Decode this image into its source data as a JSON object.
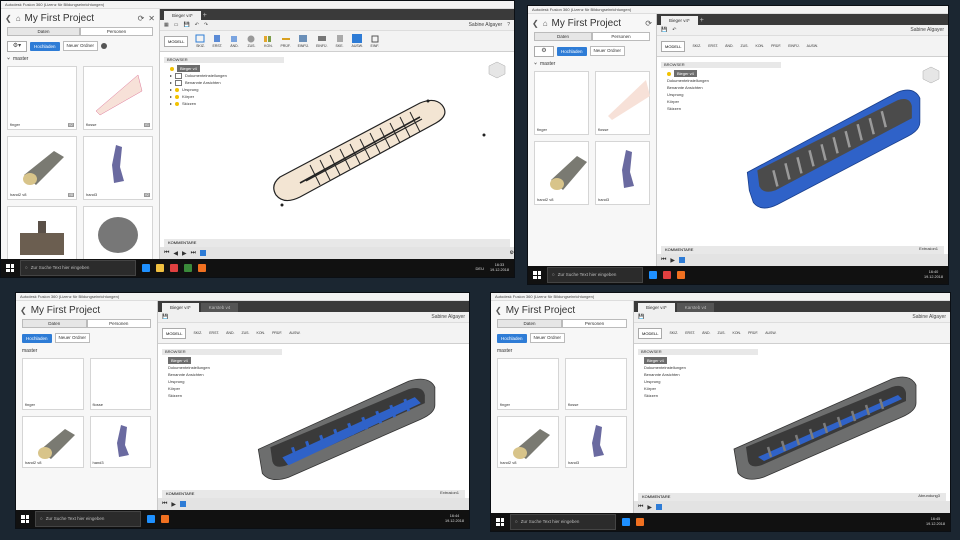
{
  "app_title": "Autodesk Fusion 360 (Lizenz für Bildungseinrichtungen)",
  "project": {
    "name": "My First Project"
  },
  "left_tabs": [
    "Daten",
    "Personen"
  ],
  "buttons": {
    "upload": "Hochladen",
    "new_folder": "Neuer Ordner"
  },
  "branch": "master",
  "thumbnails": [
    {
      "label": "finger",
      "version": "V2"
    },
    {
      "label": "flosse",
      "version": "V1"
    },
    {
      "label": "hand2 v8",
      "version": "V8"
    },
    {
      "label": "hand3",
      "version": "V2"
    },
    {
      "label": "",
      "version": ""
    },
    {
      "label": "",
      "version": ""
    }
  ],
  "doc_tab": "Bieger v4*",
  "doc_tab_2": "Karsteb v4",
  "user": "Sabine Algayer",
  "ribbon": {
    "mode": "MODELL",
    "tools": [
      "SKIZ.",
      "ERST.",
      "ÄND.",
      "ZUS.",
      "KON.",
      "PRÜF.",
      "EINFÜ.",
      "EINFÜ.",
      "SKE.",
      "AUSW.",
      "EINF."
    ]
  },
  "browser": {
    "header": "BROWSER",
    "root": "Bieger v4",
    "items": [
      "Dokumenteinstellungen",
      "Benannte Ansichten",
      "Ursprung",
      "Körper",
      "Skizzen"
    ]
  },
  "comment_label": "KOMMENTARE",
  "status": {
    "shot2": "Extrusion1",
    "shot3": "Extrusion1",
    "shot4": "Abrundung3"
  },
  "taskbar": {
    "search_placeholder": "Zur Suche Text hier eingeben",
    "times": [
      "16:33",
      "16:40",
      "16:44",
      "16:45"
    ],
    "date": "19.12.2018",
    "lang": "DEU"
  },
  "colors": {
    "accent": "#2e7cd6",
    "model_blue": "#2f62c8",
    "model_gray": "#6d6e6e",
    "sketch_fill": "#f3e5d3"
  }
}
